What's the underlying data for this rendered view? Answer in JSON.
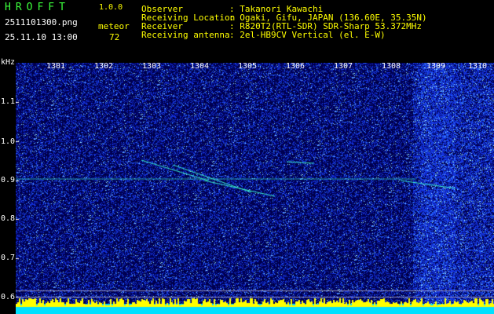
{
  "header": {
    "logo": "HROFFT",
    "version": "1.0.0",
    "filename": "2511101300.png",
    "timestamp": "25.11.10 13:00",
    "count_label": "meteor",
    "count_value": "72"
  },
  "station": {
    "rows": [
      {
        "label": "Observer",
        "value": ": Takanori Kawachi"
      },
      {
        "label": "Receiving Location",
        "value": ": Ogaki, Gifu, JAPAN (136.60E, 35.35N)"
      },
      {
        "label": "Receiver",
        "value": ": R820T2(RTL-SDR) SDR-Sharp 53.372MHz"
      },
      {
        "label": "Receiving antenna",
        "value": ": 2el-HB9CV Vertical (el. E-W)"
      }
    ]
  },
  "axis": {
    "unit": "kHz",
    "time_ticks": [
      "1301",
      "1302",
      "1303",
      "1304",
      "1305",
      "1306",
      "1307",
      "1308",
      "1309",
      "1310"
    ],
    "freq_ticks": [
      "1.1",
      "1.0",
      "0.9",
      "0.8",
      "0.7",
      "0.6"
    ]
  },
  "colors": {
    "background": "#00003a",
    "noise": "#1a3cff",
    "signal": "#3cffd0",
    "baseline": "#ffff00",
    "band": "#00e0ff"
  }
}
